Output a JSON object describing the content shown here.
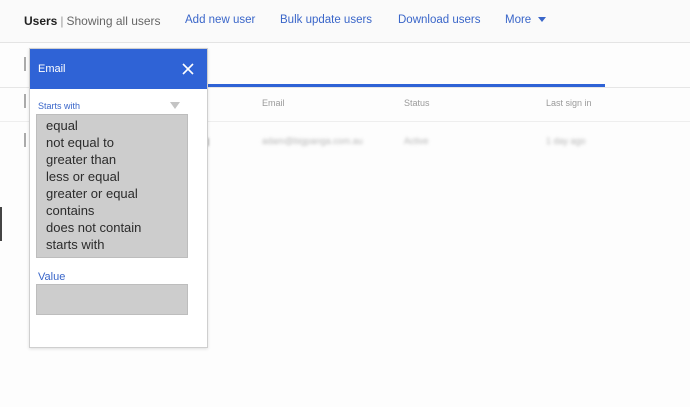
{
  "header": {
    "title": "Users",
    "subtitle": "Showing all users",
    "links": {
      "add_new_user": "Add new user",
      "bulk_update_users": "Bulk update users",
      "download_users": "Download users",
      "more": "More"
    }
  },
  "table": {
    "columns": {
      "email": "Email",
      "status": "Status",
      "last_sign_in": "Last sign in"
    },
    "blurred_row": {
      "email": "adam@bigpanga.com.au",
      "status": "Active",
      "last_sign_in": "1 day ago"
    }
  },
  "filter_popup": {
    "title": "Email",
    "condition_label": "Starts with",
    "options": [
      "equal",
      "not equal to",
      "greater than",
      "less or equal",
      "greater or equal",
      "contains",
      "does not contain",
      "starts with"
    ],
    "value_label": "Value",
    "value": ""
  },
  "colors": {
    "accent": "#2f63d6",
    "link": "#3a66c9",
    "option_bg": "#cdcdcd"
  },
  "icons": {
    "close": "close-icon",
    "dropdown": "chevron-down-icon"
  }
}
